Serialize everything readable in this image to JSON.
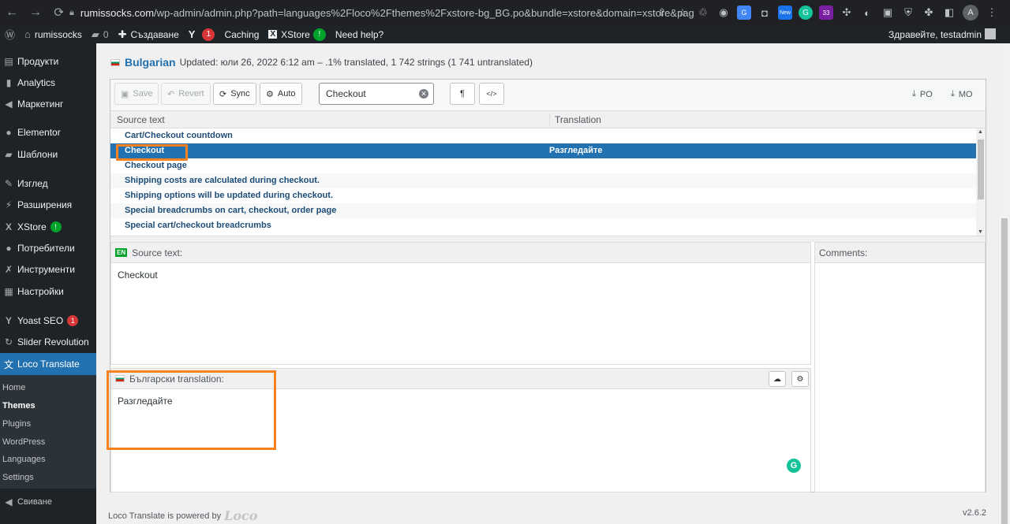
{
  "browser": {
    "url_host": "rumissocks.com",
    "url_path": "/wp-admin/admin.php?path=languages%2Floco%2Fthemes%2Fxstore-bg_BG.po&bundle=xstore&domain=xstore&page=loco-...",
    "profile_initial": "A",
    "ext_badge_new": "New",
    "ext_badge_33": "33"
  },
  "adminbar": {
    "site_name": "rumissocks",
    "comments_count": "0",
    "new_label": "Създаване",
    "yoast_count": "1",
    "caching_label": "Caching",
    "xstore_label": "XStore",
    "xstore_badge": "!",
    "help_label": "Need help?",
    "greeting": "Здравейте, testadmin"
  },
  "sidebar": {
    "items": [
      {
        "label": "Продукти"
      },
      {
        "label": "Analytics"
      },
      {
        "label": "Маркетинг"
      },
      {
        "label": "Elementor"
      },
      {
        "label": "Шаблони"
      },
      {
        "label": "Изглед"
      },
      {
        "label": "Разширения"
      },
      {
        "label": "XStore",
        "badge": "!"
      },
      {
        "label": "Потребители"
      },
      {
        "label": "Инструменти"
      },
      {
        "label": "Настройки"
      },
      {
        "label": "Yoast SEO",
        "badge": "1"
      },
      {
        "label": "Slider Revolution"
      },
      {
        "label": "Loco Translate"
      }
    ],
    "submenu": [
      "Home",
      "Themes",
      "Plugins",
      "WordPress",
      "Languages",
      "Settings"
    ],
    "collapse_label": "Свиване"
  },
  "header": {
    "language": "Bulgarian",
    "meta": "Updated: юли 26, 2022 6:12 am – .1% translated, 1 742 strings (1 741 untranslated)"
  },
  "toolbar": {
    "save": "Save",
    "revert": "Revert",
    "sync": "Sync",
    "auto": "Auto",
    "search_value": "Checkout",
    "invisibles": "¶",
    "code": "</>",
    "po": "PO",
    "mo": "MO"
  },
  "grid": {
    "col_source": "Source text",
    "col_translation": "Translation",
    "rows": [
      {
        "source": "Cart/Checkout countdown",
        "translation": ""
      },
      {
        "source": "Checkout",
        "translation": "Разгледайте"
      },
      {
        "source": "Checkout page",
        "translation": ""
      },
      {
        "source": "Shipping costs are calculated during checkout.",
        "translation": ""
      },
      {
        "source": "Shipping options will be updated during checkout.",
        "translation": ""
      },
      {
        "source": "Special breadcrumbs on cart, checkout, order page",
        "translation": ""
      },
      {
        "source": "Special cart/checkout breadcrumbs",
        "translation": ""
      }
    ]
  },
  "source_pane": {
    "badge": "EN",
    "label": "Source text:",
    "text": "Checkout"
  },
  "translation_pane": {
    "label": "Български translation:",
    "text": "Разгледайте"
  },
  "comments_pane": {
    "label": "Comments:"
  },
  "footer": {
    "powered": "Loco Translate is powered by",
    "logo": "Loco",
    "version": "v2.6.2"
  },
  "colors": {
    "wp_dark": "#1d2327",
    "wp_blue": "#2271b1",
    "highlight": "#f5821f"
  }
}
